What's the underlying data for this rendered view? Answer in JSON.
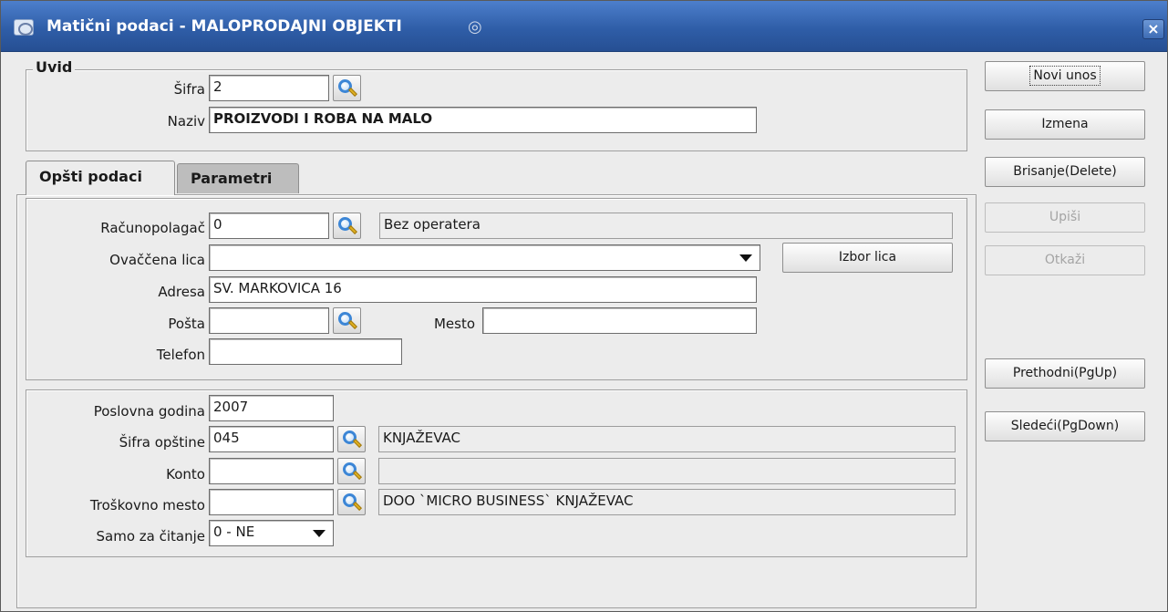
{
  "window": {
    "title": "Matični podaci - MALOPRODAJNI OBJEKTI",
    "close_glyph": "×"
  },
  "uvid": {
    "legend": "Uvid",
    "sifra_label": "Šifra",
    "sifra_value": "2",
    "naziv_label": "Naziv",
    "naziv_value": "PROIZVODI I ROBA NA MALO"
  },
  "tabs": [
    {
      "label": "Opšti podaci",
      "active": true
    },
    {
      "label": "Parametri",
      "active": false
    }
  ],
  "general": {
    "racunopolagac_label": "Računopolagač",
    "racunopolagac_value": "0",
    "racunopolagac_name": "Bez operatera",
    "ovlascena_label": "Ovaččena lica",
    "ovlascena_value": "",
    "izbor_lica_label": "Izbor lica",
    "adresa_label": "Adresa",
    "adresa_value": "SV. MARKOVICA 16",
    "posta_label": "Pošta",
    "posta_value": "",
    "mesto_label": "Mesto",
    "mesto_value": "",
    "telefon_label": "Telefon",
    "telefon_value": ""
  },
  "details": {
    "poslovna_godina_label": "Poslovna godina",
    "poslovna_godina_value": "2007",
    "sifra_opstine_label": "Šifra opštine",
    "sifra_opstine_value": "045",
    "sifra_opstine_name": "KNJAŽEVAC",
    "konto_label": "Konto",
    "konto_value": "",
    "konto_name": "",
    "troskovno_label": "Troškovno mesto",
    "troskovno_value": "",
    "troskovno_name": "DOO `MICRO BUSINESS` KNJAŽEVAC",
    "samo_label": "Samo za čitanje",
    "samo_value": "0 - NE"
  },
  "actions": {
    "novi_unos": "Novi unos",
    "izmena": "Izmena",
    "brisanje": "Brisanje(Delete)",
    "upisi": "Upiši",
    "otkazi": "Otkaži",
    "prethodni": "Prethodni(PgUp)",
    "sledeci": "Sledeći(PgDown)"
  }
}
